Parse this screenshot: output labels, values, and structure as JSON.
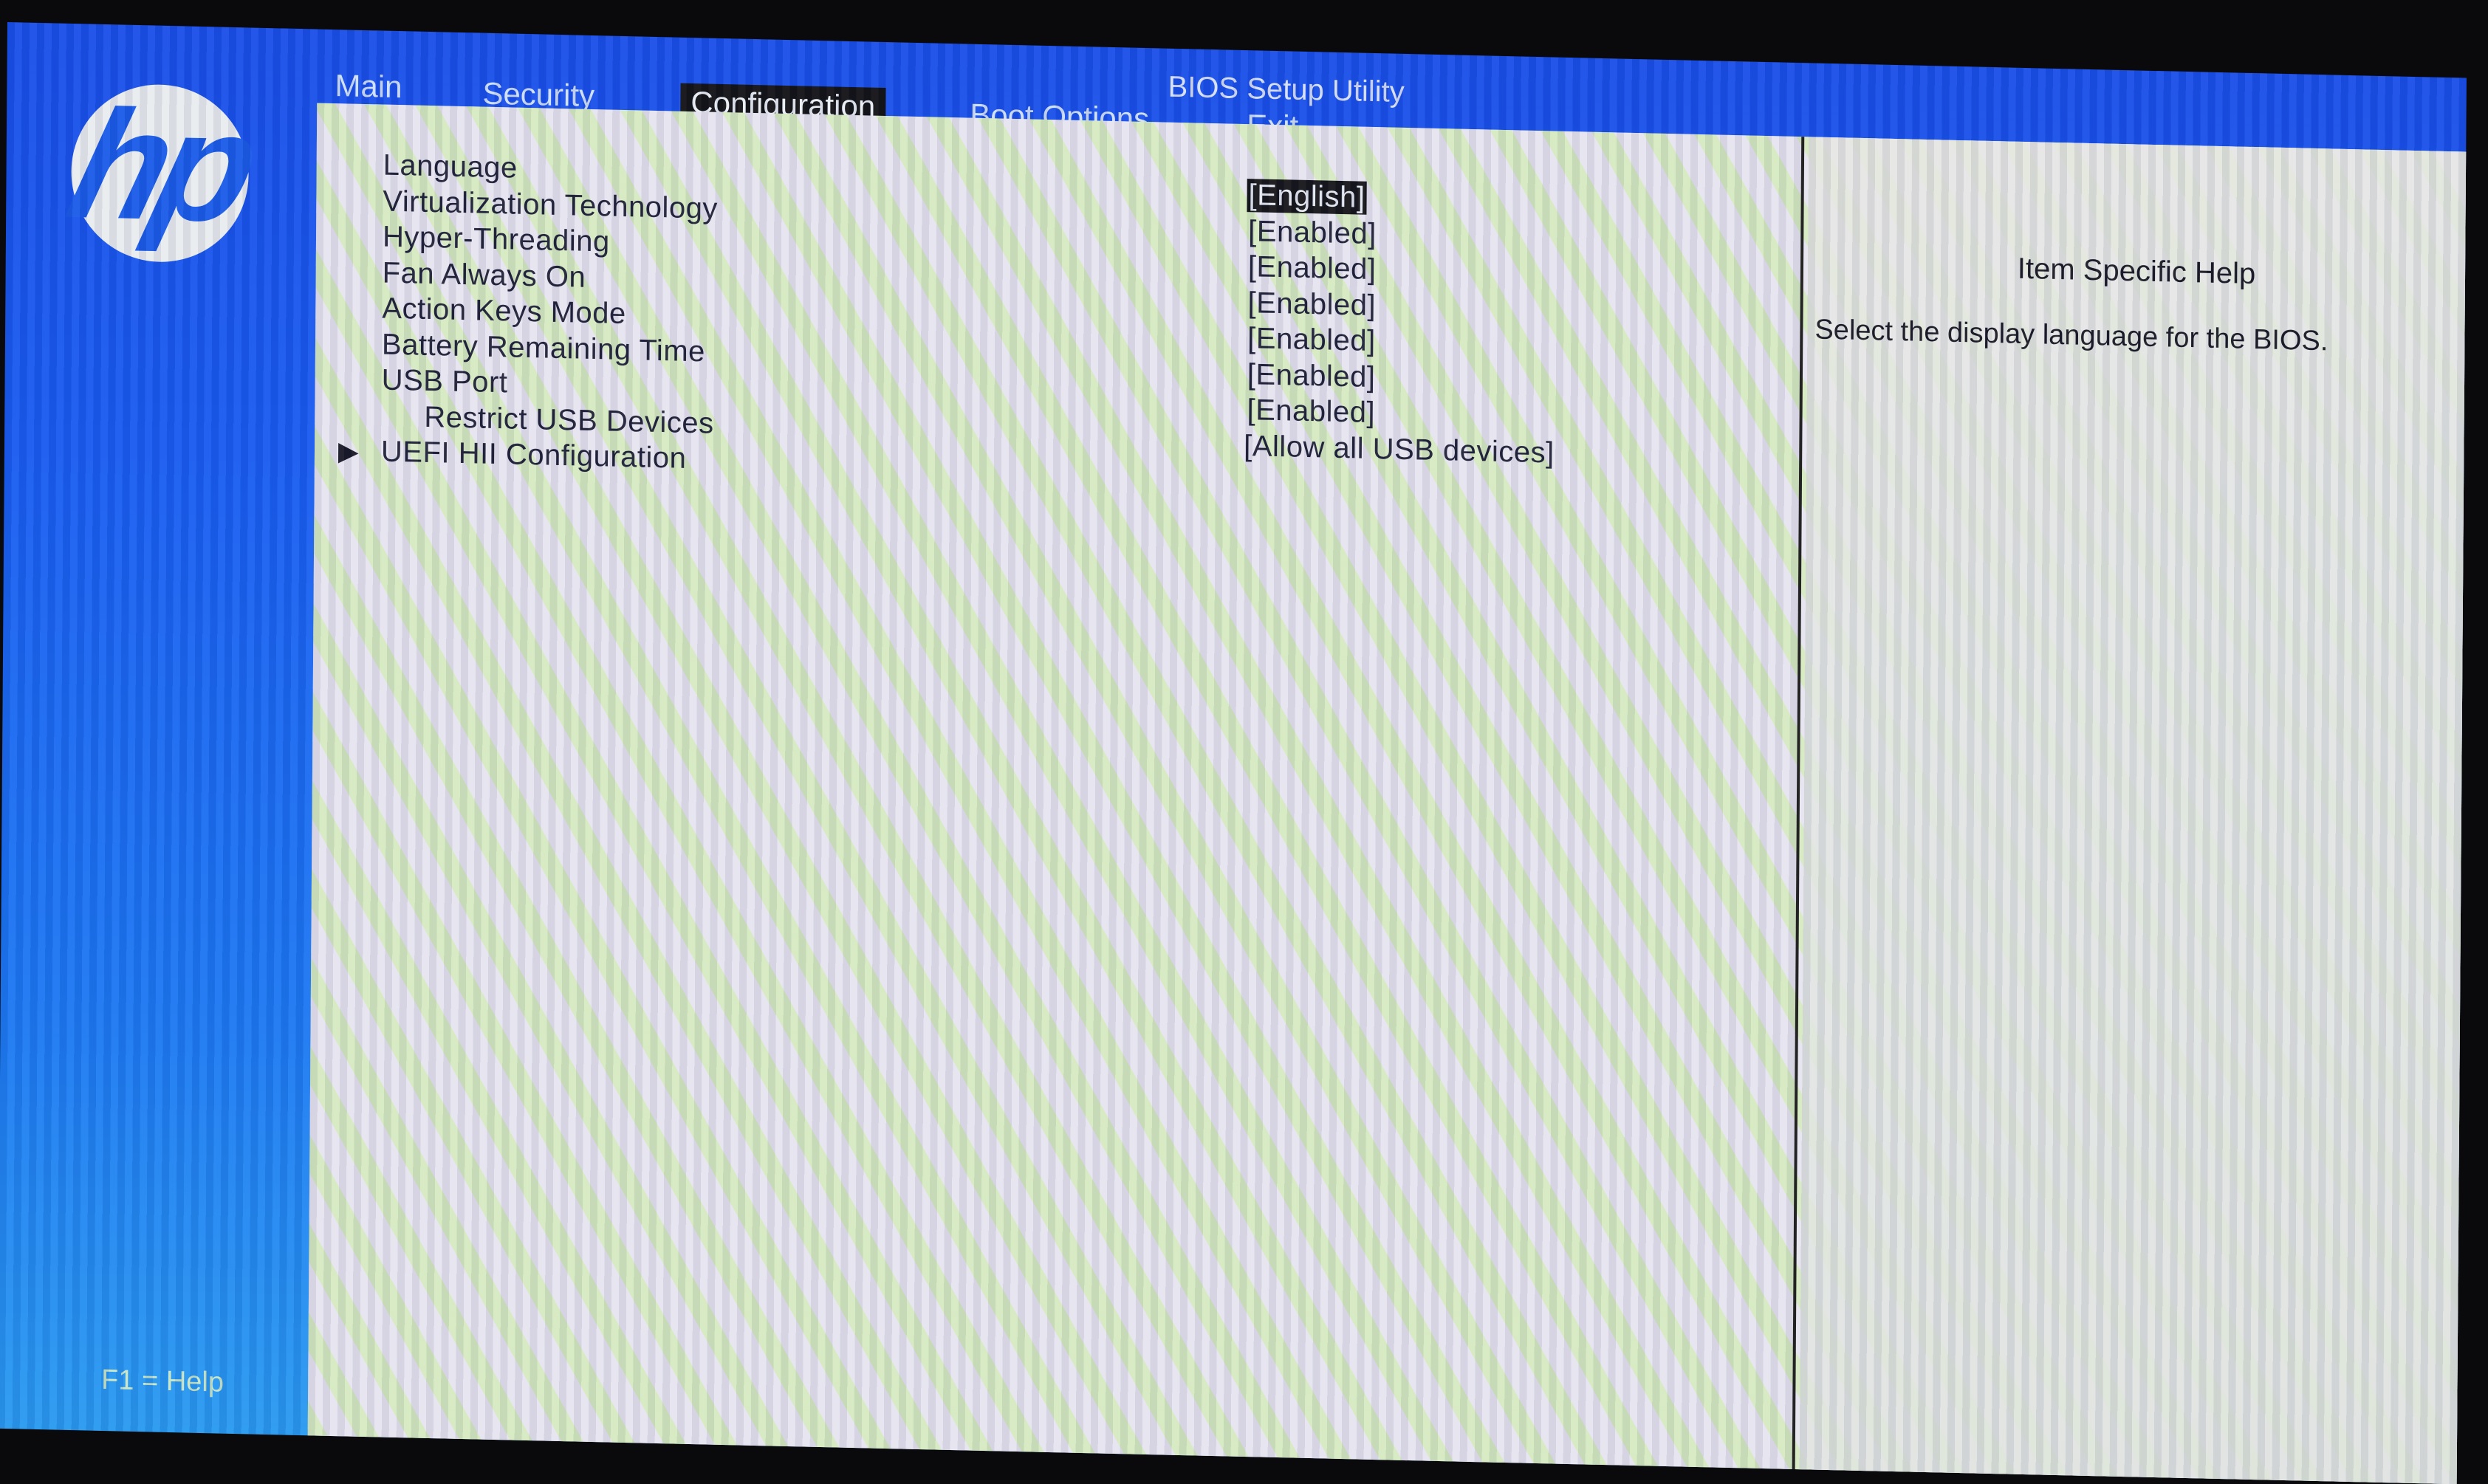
{
  "app": {
    "title": "BIOS Setup Utility",
    "logo_text": "hp"
  },
  "menu": {
    "tabs": [
      {
        "label": "Main",
        "active": false
      },
      {
        "label": "Security",
        "active": false
      },
      {
        "label": "Configuration",
        "active": true
      },
      {
        "label": "Boot Options",
        "active": false
      },
      {
        "label": "Exit",
        "active": false
      }
    ]
  },
  "settings": {
    "items": [
      {
        "label": "Language",
        "value": "[English]",
        "selected": true,
        "submenu": false,
        "indent": false
      },
      {
        "label": "Virtualization Technology",
        "value": "[Enabled]",
        "selected": false,
        "submenu": false,
        "indent": false
      },
      {
        "label": "Hyper-Threading",
        "value": "[Enabled]",
        "selected": false,
        "submenu": false,
        "indent": false
      },
      {
        "label": "Fan Always On",
        "value": "[Enabled]",
        "selected": false,
        "submenu": false,
        "indent": false
      },
      {
        "label": "Action Keys Mode",
        "value": "[Enabled]",
        "selected": false,
        "submenu": false,
        "indent": false
      },
      {
        "label": "Battery Remaining Time",
        "value": "[Enabled]",
        "selected": false,
        "submenu": false,
        "indent": false
      },
      {
        "label": "USB Port",
        "value": "[Enabled]",
        "selected": false,
        "submenu": false,
        "indent": false
      },
      {
        "label": "Restrict USB Devices",
        "value": "[Allow all USB devices]",
        "selected": false,
        "submenu": false,
        "indent": true
      },
      {
        "label": "UEFI HII Configuration",
        "value": "",
        "selected": false,
        "submenu": true,
        "indent": false
      }
    ],
    "submenu_icon": "triangle-right"
  },
  "help": {
    "title": "Item Specific Help",
    "text": "Select the display language for the BIOS."
  },
  "footer": {
    "hint": "F1 = Help"
  },
  "colors": {
    "frame_blue": "#1a5cf0",
    "selection_bg": "#17171c",
    "panel_bg": "#e6e8ea",
    "text_dark": "#22233a"
  }
}
